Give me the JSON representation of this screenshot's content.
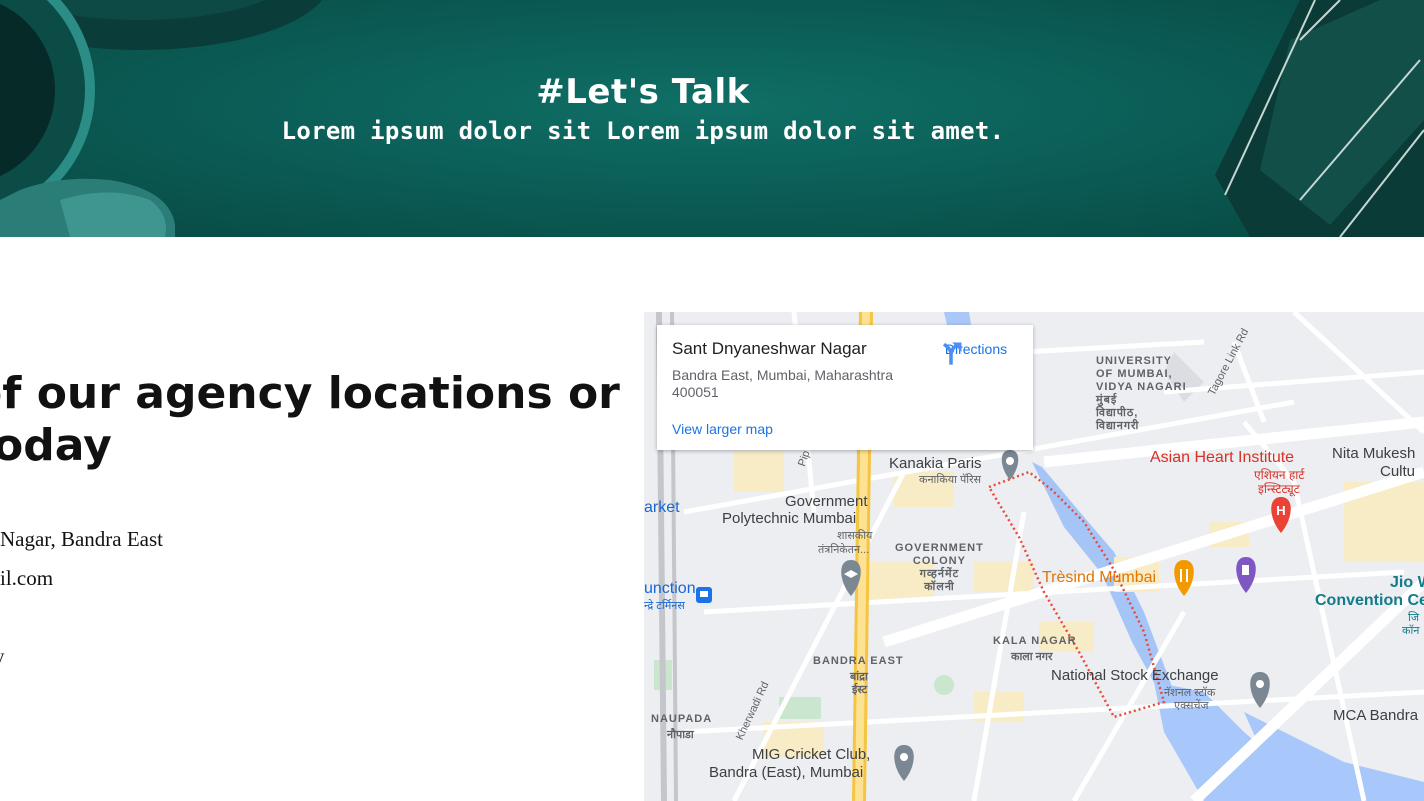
{
  "hero": {
    "title": "#Let's Talk",
    "subtitle": "Lorem ipsum dolor sit Lorem ipsum dolor sit amet."
  },
  "contact": {
    "headline_line1": "of our agency locations or",
    "headline_line2": "today",
    "address": "Nagar, Bandra East",
    "email": "il.com",
    "extra": "y"
  },
  "map": {
    "place_name": "Sant Dnyaneshwar Nagar",
    "address": "Bandra East, Mumbai, Maharashtra 400051",
    "directions_label": "Directions",
    "view_larger_label": "View larger map",
    "labels": {
      "university": [
        "UNIVERSITY",
        "OF MUMBAI,",
        "VIDYA NAGARI",
        "मुंबई",
        "विद्यापीठ,",
        "विद्यानगरी"
      ],
      "tagore": "Tagore Link Rd",
      "kanakia": "Kanakia Paris",
      "kanakia_local": "कनाकिया पॅरिस",
      "asian_heart": "Asian Heart Institute",
      "asian_heart_local1": "एशियन हार्ट",
      "asian_heart_local2": "इन्स्टिट्यूट",
      "nita": "Nita Mukesh",
      "nita2": "Cultu",
      "market": "arket",
      "govt_poly1": "Government",
      "govt_poly2": "Polytechnic Mumbai",
      "govt_poly_local1": "शासकीय",
      "govt_poly_local2": "तंत्रनिकेतन...",
      "govt_colony": [
        "GOVERNMENT",
        "COLONY",
        "गव्हर्नमेंट",
        "कॉलनी"
      ],
      "tresind": "Trèsind Mumbai",
      "jio1": "Jio W",
      "jio2": "Convention Ce",
      "jio_local1": "जि",
      "jio_local2": "कॉन",
      "junction1": "unction",
      "junction2": "न्द्रे टर्मिनस",
      "kala_nagar": "KALA NAGAR",
      "kala_nagar_local": "काला नगर",
      "bandra_east": "BANDRA EAST",
      "bandra_east_local1": "बांद्रा",
      "bandra_east_local2": "ईस्ट",
      "nse": "National Stock Exchange",
      "nse_local1": "नॅशनल स्टॉक",
      "nse_local2": "एक्सचेंज",
      "mca": "MCA Bandra",
      "naupada": "NAUPADA",
      "naupada_local": "नौपाडा",
      "kherwadi": "Kherwadi Rd",
      "mig1": "MIG Cricket Club,",
      "mig2": "Bandra (East), Mumbai",
      "pipeline": "Pip"
    }
  },
  "colors": {
    "hero_bg": "#0b5e57",
    "link_blue": "#1a73e8",
    "map_red": "#d93025",
    "map_orange": "#e37400"
  },
  "icons": [
    "directions-icon",
    "pin-icon",
    "hospital-icon",
    "restaurant-icon",
    "fuel-icon",
    "school-icon",
    "train-icon"
  ]
}
